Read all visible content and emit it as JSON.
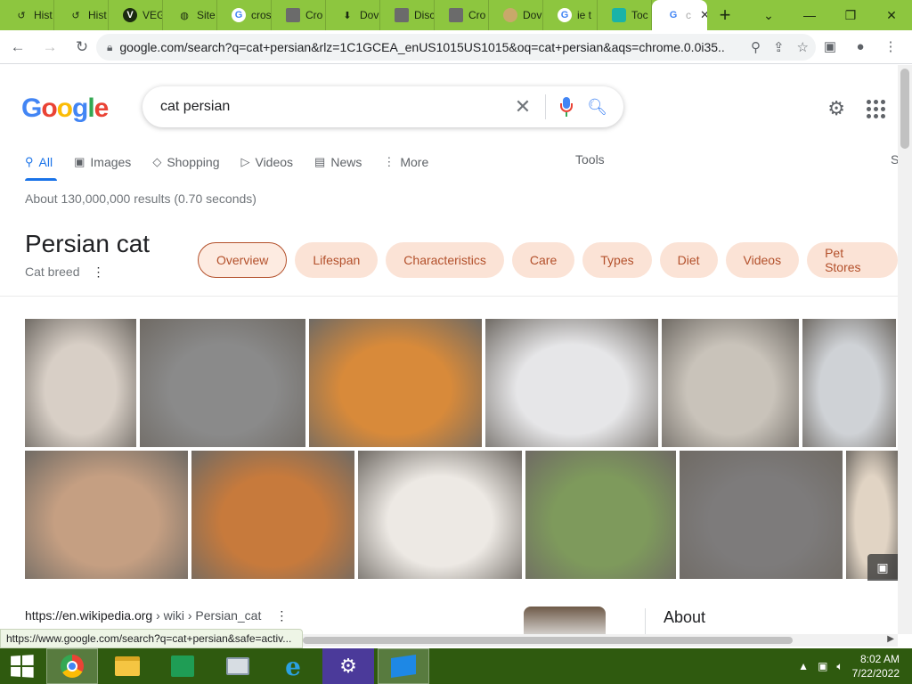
{
  "browser": {
    "tabs": [
      {
        "label": "Hist",
        "icon": "history-icon"
      },
      {
        "label": "Hist",
        "icon": "history-icon"
      },
      {
        "label": "VEG",
        "icon": "v-site-icon"
      },
      {
        "label": "Site",
        "icon": "globe-icon"
      },
      {
        "label": "cros",
        "icon": "google-icon"
      },
      {
        "label": "Cro",
        "icon": "page-icon"
      },
      {
        "label": "Dov",
        "icon": "download-icon"
      },
      {
        "label": "Disc",
        "icon": "page-icon"
      },
      {
        "label": "Cro",
        "icon": "page-icon"
      },
      {
        "label": "Dov",
        "icon": "animal-icon"
      },
      {
        "label": "ie t",
        "icon": "google-icon"
      },
      {
        "label": "Toc",
        "icon": "teal-icon"
      }
    ],
    "active_tab_label": "c",
    "url": "google.com/search?q=cat+persian&rlz=1C1GCEA_enUS1015US1015&oq=cat+persian&aqs=chrome.0.0i35..."
  },
  "search": {
    "query": "cat persian",
    "tabs": [
      "All",
      "Images",
      "Shopping",
      "Videos",
      "News",
      "More"
    ],
    "tools_label": "Tools",
    "settings_cut_label": "S",
    "stats": "About 130,000,000 results (0.70 seconds)"
  },
  "knowledge": {
    "title": "Persian cat",
    "subtitle": "Cat breed",
    "chips": [
      "Overview",
      "Lifespan",
      "Characteristics",
      "Care",
      "Types",
      "Diet",
      "Videos",
      "Pet Stores"
    ]
  },
  "images": {
    "row1": [
      {
        "name": "white-persian-kitten",
        "color": "#d8cfc6"
      },
      {
        "name": "gray-fluffy-persian",
        "color": "#8a8a8a"
      },
      {
        "name": "orange-persian",
        "color": "#d88a3a"
      },
      {
        "name": "white-chinchilla-persian",
        "color": "#e6e6e8"
      },
      {
        "name": "silver-persian-sitting",
        "color": "#c9c3ba"
      },
      {
        "name": "white-persian-closeup",
        "color": "#cfd2d6"
      }
    ],
    "row2": [
      {
        "name": "cream-persian",
        "color": "#c59f82"
      },
      {
        "name": "ginger-persian",
        "color": "#c77a3c"
      },
      {
        "name": "white-persian-lying",
        "color": "#ede9e4"
      },
      {
        "name": "white-persian-grass",
        "color": "#7e9a5c"
      },
      {
        "name": "gray-persian-couch",
        "color": "#7d7b7b"
      },
      {
        "name": "cream-persian-partial",
        "color": "#e1d4c4"
      }
    ]
  },
  "result": {
    "url": "https://en.wikipedia.org",
    "crumbs": "› wiki › Persian_cat",
    "about": "About"
  },
  "status_url": "https://www.google.com/search?q=cat+persian&safe=activ...",
  "clock": {
    "time": "8:02 AM",
    "date": "7/22/2022"
  },
  "colors": {
    "tabstrip": "#8dc63f",
    "taskbar": "#2f5a0f",
    "chip_bg": "#fbe3d6",
    "chip_text": "#b3502b",
    "accent": "#1a73e8"
  }
}
